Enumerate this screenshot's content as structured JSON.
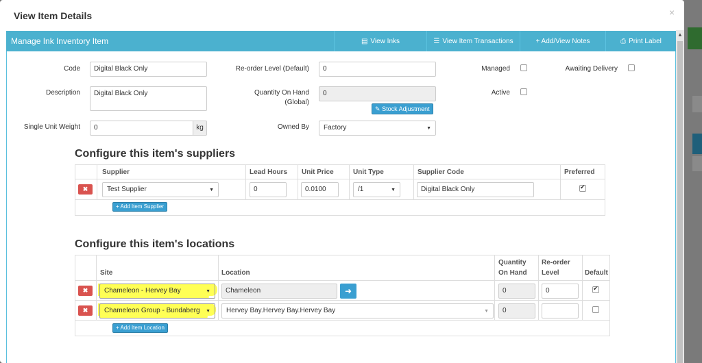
{
  "modal": {
    "title": "View Item Details",
    "close": "×"
  },
  "panel": {
    "title": "Manage Ink Inventory Item",
    "buttons": [
      {
        "icon": "list-icon",
        "label": "View Inks"
      },
      {
        "icon": "list-icon",
        "label": "View Item Transactions"
      },
      {
        "icon": "plus-icon",
        "label": "+ Add/View Notes"
      },
      {
        "icon": "print-icon",
        "label": "Print Label"
      }
    ]
  },
  "form": {
    "code_label": "Code",
    "code_value": "Digital Black Only",
    "description_label": "Description",
    "description_value": "Digital Black Only",
    "weight_label": "Single Unit Weight",
    "weight_value": "0",
    "weight_unit": "kg",
    "reorder_label": "Re-order Level (Default)",
    "reorder_value": "0",
    "qty_label_1": "Quantity On Hand",
    "qty_label_2": "(Global)",
    "qty_value": "0",
    "stock_adjustment": "Stock Adjustment",
    "owned_label": "Owned By",
    "owned_value": "Factory",
    "managed_label": "Managed",
    "active_label": "Active",
    "awaiting_label": "Awaiting Delivery"
  },
  "suppliers": {
    "heading": "Configure this item's suppliers",
    "columns": [
      "Supplier",
      "Lead Hours",
      "Unit Price",
      "Unit Type",
      "Supplier Code",
      "Preferred"
    ],
    "rows": [
      {
        "supplier": "Test Supplier",
        "lead_hours": "0",
        "unit_price": "0.0100",
        "unit_type": "/1",
        "supplier_code": "Digital Black Only",
        "preferred": true
      }
    ],
    "add_button": "+ Add Item Supplier"
  },
  "locations": {
    "heading": "Configure this item's locations",
    "columns": {
      "site": "Site",
      "location": "Location",
      "qty_1": "Quantity",
      "qty_2": "On Hand",
      "reorder_1": "Re-order",
      "reorder_2": "Level",
      "default": "Default"
    },
    "rows": [
      {
        "site": "Chameleon - Hervey Bay",
        "location": "Chameleon",
        "qty": "0",
        "reorder": "0",
        "default": true
      },
      {
        "site": "Chameleon Group - Bundaberg",
        "location": "Hervey Bay.Hervey Bay.Hervey Bay",
        "qty": "0",
        "reorder": "",
        "default": false
      }
    ],
    "add_button": "+ Add Item Location"
  },
  "colors": {
    "header": "#4bb1cf",
    "danger": "#d9534f",
    "primary": "#3a9fd1",
    "highlight": "#ffff55"
  }
}
